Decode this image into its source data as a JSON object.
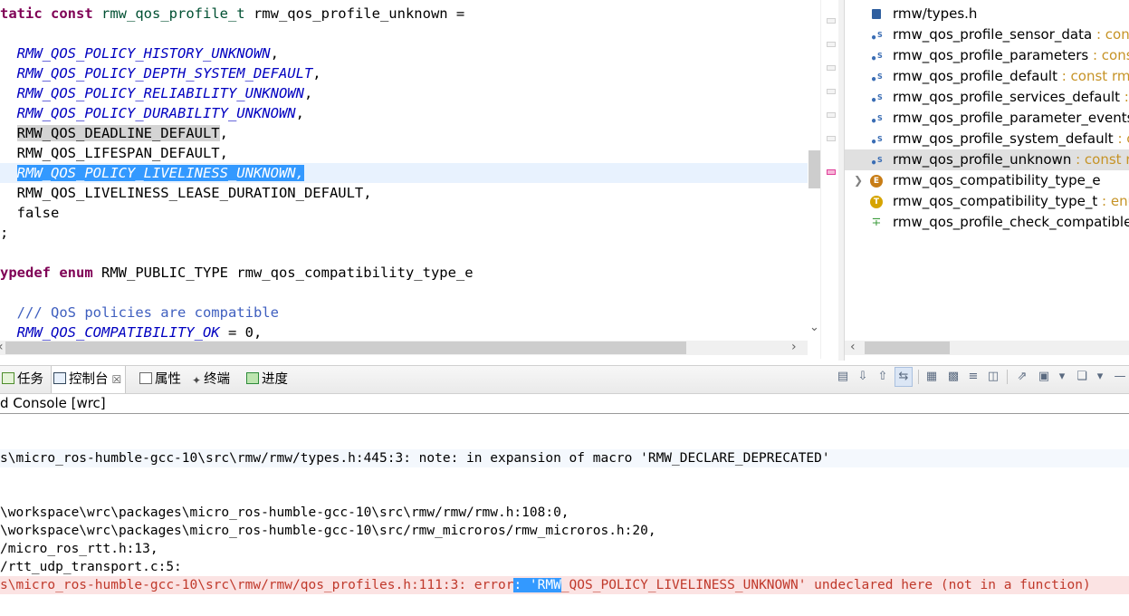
{
  "editor": {
    "lines": [
      [
        {
          "t": "tatic ",
          "c": "kw"
        },
        {
          "t": "const ",
          "c": "kw"
        },
        {
          "t": "rmw_qos_profile_t",
          "c": "ty"
        },
        {
          "t": " rmw_qos_profile_unknown =",
          "c": ""
        }
      ],
      [],
      [
        {
          "t": "  ",
          "c": ""
        },
        {
          "t": "RMW_QOS_POLICY_HISTORY_UNKNOWN",
          "c": "macro"
        },
        {
          "t": ",",
          "c": ""
        }
      ],
      [
        {
          "t": "  ",
          "c": ""
        },
        {
          "t": "RMW_QOS_POLICY_DEPTH_SYSTEM_DEFAULT",
          "c": "macro"
        },
        {
          "t": ",",
          "c": ""
        }
      ],
      [
        {
          "t": "  ",
          "c": ""
        },
        {
          "t": "RMW_QOS_POLICY_RELIABILITY_UNKNOWN",
          "c": "macro"
        },
        {
          "t": ",",
          "c": ""
        }
      ],
      [
        {
          "t": "  ",
          "c": ""
        },
        {
          "t": "RMW_QOS_POLICY_DURABILITY_UNKNOWN",
          "c": "macro"
        },
        {
          "t": ",",
          "c": ""
        }
      ],
      [
        {
          "t": "  ",
          "c": ""
        },
        {
          "t": "RMW_QOS_DEADLINE_DEFAULT",
          "c": "occ"
        },
        {
          "t": ",",
          "c": ""
        }
      ],
      [
        {
          "t": "  RMW_QOS_LIFESPAN_DEFAULT,",
          "c": ""
        }
      ],
      [
        {
          "t": "  ",
          "c": ""
        },
        {
          "t": "RMW_QOS_POLICY_LIVELINESS_UNKNOWN,",
          "c": "sel macro"
        }
      ],
      [
        {
          "t": "  RMW_QOS_LIVELINESS_LEASE_DURATION_DEFAULT,",
          "c": ""
        }
      ],
      [
        {
          "t": "  false",
          "c": ""
        }
      ],
      [
        {
          "t": ";",
          "c": ""
        }
      ],
      [],
      [
        {
          "t": "ypedef ",
          "c": "kw"
        },
        {
          "t": "enum ",
          "c": "kw"
        },
        {
          "t": "RMW_PUBLIC_TYPE rmw_qos_compatibility_type_e",
          "c": ""
        }
      ],
      [],
      [
        {
          "t": "  ",
          "c": ""
        },
        {
          "t": "/// QoS policies are compatible",
          "c": "cm"
        }
      ],
      [
        {
          "t": "  ",
          "c": ""
        },
        {
          "t": "RMW_QOS_COMPATIBILITY_OK",
          "c": "macro"
        },
        {
          "t": " = 0,",
          "c": ""
        }
      ]
    ]
  },
  "outline": {
    "items": [
      {
        "icon": "header-file-icon",
        "label": "rmw/types.h",
        "type": ""
      },
      {
        "icon": "static-variable-icon",
        "label": "rmw_qos_profile_sensor_data",
        "type": " : cons"
      },
      {
        "icon": "static-variable-icon",
        "label": "rmw_qos_profile_parameters",
        "type": " : const"
      },
      {
        "icon": "static-variable-icon",
        "label": "rmw_qos_profile_default",
        "type": " : const rmw"
      },
      {
        "icon": "static-variable-icon",
        "label": "rmw_qos_profile_services_default",
        "type": " : c"
      },
      {
        "icon": "static-variable-icon",
        "label": "rmw_qos_profile_parameter_events",
        "type": ""
      },
      {
        "icon": "static-variable-icon",
        "label": "rmw_qos_profile_system_default",
        "type": " : co"
      },
      {
        "icon": "static-variable-error-icon",
        "label": "rmw_qos_profile_unknown",
        "type": " : const rm",
        "selected": true
      },
      {
        "icon": "enum-icon",
        "label": "rmw_qos_compatibility_type_e",
        "type": "",
        "expandable": true
      },
      {
        "icon": "typedef-icon",
        "label": "rmw_qos_compatibility_type_t",
        "type": " : enu"
      },
      {
        "icon": "function-icon",
        "label": "rmw_qos_profile_check_compatible",
        "type": ""
      }
    ]
  },
  "tabs": [
    {
      "name": "tab-tasks",
      "icon": "task-icon",
      "label": "任务"
    },
    {
      "name": "tab-console",
      "icon": "console-icon",
      "label": "控制台",
      "active": true,
      "close": "☒"
    },
    {
      "name": "tab-properties",
      "icon": "properties-icon",
      "label": "属性"
    },
    {
      "name": "tab-terminal",
      "icon": "terminal-icon",
      "label": "终端"
    },
    {
      "name": "tab-progress",
      "icon": "progress-icon",
      "label": "进度"
    }
  ],
  "console": {
    "title": "d Console [wrc]",
    "lines": [
      {
        "text": "",
        "kind": ""
      },
      {
        "text": "s\\micro_ros-humble-gcc-10\\src\\rmw/rmw/types.h:445:3: note: in expansion of macro 'RMW_DECLARE_DEPRECATED'",
        "kind": "note"
      },
      {
        "text": "",
        "kind": ""
      },
      {
        "text": "",
        "kind": ""
      },
      {
        "text": "\\workspace\\wrc\\packages\\micro_ros-humble-gcc-10\\src\\rmw/rmw/rmw.h:108:0,",
        "kind": ""
      },
      {
        "text": "\\workspace\\wrc\\packages\\micro_ros-humble-gcc-10\\src/rmw_microros/rmw_microros.h:20,",
        "kind": ""
      },
      {
        "text": "/micro_ros_rtt.h:13,",
        "kind": ""
      },
      {
        "text": "/rtt_udp_transport.c:5:",
        "kind": ""
      },
      {
        "text": "s\\micro_ros-humble-gcc-10\\src\\rmw/rmw/qos_profiles.h:111:3: error",
        "kind": "error",
        "sel": ": 'RMW",
        "rest": "_QOS_POLICY_LIVELINESS_UNKNOWN' undeclared here (not in a function)"
      }
    ]
  },
  "colors": {
    "keyword": "#7f0055",
    "macro": "#0000c0",
    "comment": "#3f5fbf",
    "selection": "#3399ff",
    "error_text": "#c0392b",
    "error_bg": "#fbe3e3"
  }
}
